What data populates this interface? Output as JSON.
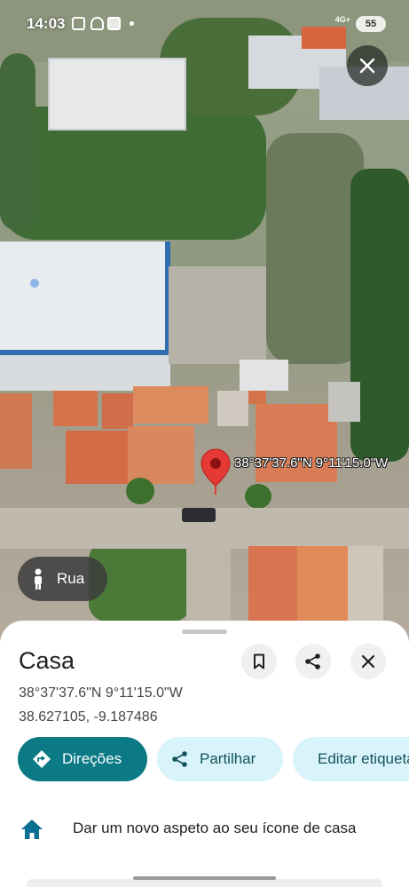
{
  "status_bar": {
    "time": "14:03",
    "network": "4G+",
    "battery": "55"
  },
  "map": {
    "pin_coordinates": "38°37'37.6\"N 9°11'15.0\"W",
    "street_view_label": "Rua"
  },
  "place": {
    "title": "Casa",
    "coordinates_dms": "38°37'37.6\"N 9°11'15.0\"W",
    "coordinates_decimal": "38.627105, -9.187486"
  },
  "actions": {
    "directions": "Direções",
    "share": "Partilhar",
    "edit": "Editar etiqueta"
  },
  "tip": {
    "text": "Dar um novo aspeto ao seu ícone de casa"
  },
  "colors": {
    "primary": "#0b7a84",
    "secondary_chip": "#d9f3fb",
    "pin": "#e53935"
  },
  "icons": [
    "save-icon",
    "share-icon",
    "close-icon",
    "directions-icon",
    "flag-icon",
    "home-icon",
    "pegman-icon"
  ]
}
